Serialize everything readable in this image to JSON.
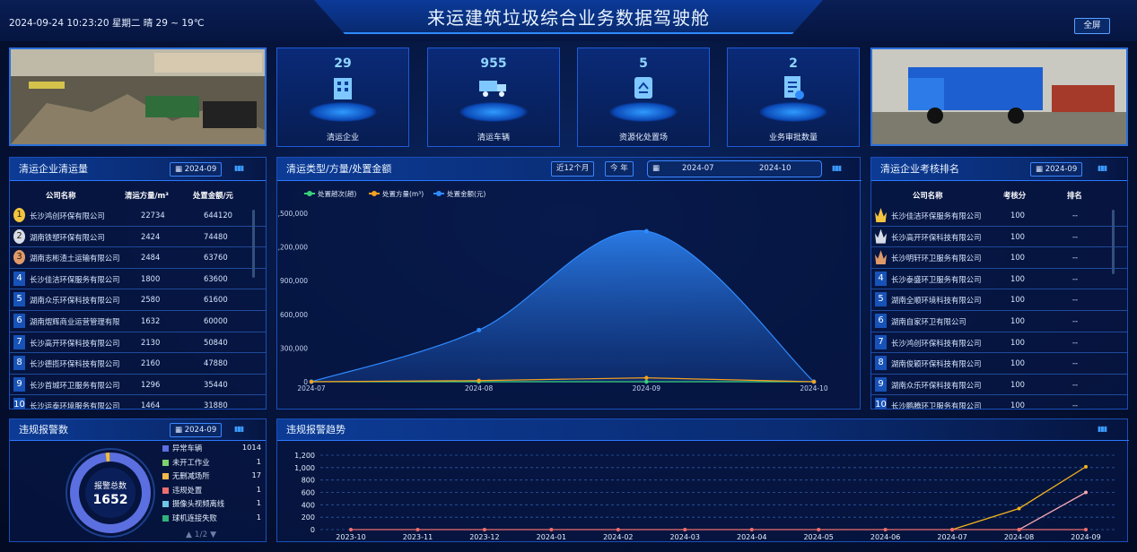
{
  "header": {
    "datetime": "2024-09-24 10:23:20 星期二 晴 29 ~ 19℃",
    "title": "来运建筑垃圾综合业务数据驾驶舱",
    "fullscreen_label": "全屏"
  },
  "stats": [
    {
      "value": "29",
      "label": "清运企业",
      "icon": "building-icon"
    },
    {
      "value": "955",
      "label": "清运车辆",
      "icon": "truck-icon"
    },
    {
      "value": "5",
      "label": "资源化处置场",
      "icon": "recycle-bin-icon"
    },
    {
      "value": "2",
      "label": "业务审批数量",
      "icon": "document-approval-icon"
    }
  ],
  "left_panel": {
    "title": "清运企业清运量",
    "date": "2024-09",
    "headers": [
      "公司名称",
      "清运方量/m³",
      "处置金额/元"
    ],
    "rows": [
      {
        "rank": "1",
        "name": "长沙鸿创环保有限公司",
        "volume": "22734",
        "amount": "644120"
      },
      {
        "rank": "2",
        "name": "湖南铁塑环保有限公司",
        "volume": "2424",
        "amount": "74480"
      },
      {
        "rank": "3",
        "name": "湖南志彬渣土运输有限公司",
        "volume": "2484",
        "amount": "63760"
      },
      {
        "rank": "4",
        "name": "长沙佳洁环保服务有限公司",
        "volume": "1800",
        "amount": "63600"
      },
      {
        "rank": "5",
        "name": "湖南众乐环保科技有限公司",
        "volume": "2580",
        "amount": "61600"
      },
      {
        "rank": "6",
        "name": "湖南熠辉商业运营管理有限公司",
        "volume": "1632",
        "amount": "60000"
      },
      {
        "rank": "7",
        "name": "长沙高开环保科技有限公司",
        "volume": "2130",
        "amount": "50840"
      },
      {
        "rank": "8",
        "name": "长沙德揽环保科技有限公司",
        "volume": "2160",
        "amount": "47880"
      },
      {
        "rank": "9",
        "name": "长沙首城环卫服务有限公司",
        "volume": "1296",
        "amount": "35440"
      },
      {
        "rank": "10",
        "name": "长沙运泰环境服务有限公司",
        "volume": "1464",
        "amount": "31880"
      }
    ]
  },
  "right_panel": {
    "title": "清运企业考核排名",
    "date": "2024-09",
    "headers": [
      "公司名称",
      "考核分",
      "排名"
    ],
    "rows": [
      {
        "rank": "1",
        "name": "长沙佳洁环保服务有限公司",
        "score": "100",
        "place": "--"
      },
      {
        "rank": "2",
        "name": "长沙高开环保科技有限公司",
        "score": "100",
        "place": "--"
      },
      {
        "rank": "3",
        "name": "长沙明轩环卫服务有限公司",
        "score": "100",
        "place": "--"
      },
      {
        "rank": "4",
        "name": "长沙泰盛环卫服务有限公司",
        "score": "100",
        "place": "--"
      },
      {
        "rank": "5",
        "name": "湖南全顺环境科技有限公司",
        "score": "100",
        "place": "--"
      },
      {
        "rank": "6",
        "name": "湖南自家环卫有限公司",
        "score": "100",
        "place": "--"
      },
      {
        "rank": "7",
        "name": "长沙鸿创环保科技有限公司",
        "score": "100",
        "place": "--"
      },
      {
        "rank": "8",
        "name": "湖南俊颖环保科技有限公司",
        "score": "100",
        "place": "--"
      },
      {
        "rank": "9",
        "name": "湖南众乐环保科技有限公司",
        "score": "100",
        "place": "--"
      },
      {
        "rank": "10",
        "name": "长沙鹏腾环卫服务有限公司",
        "score": "100",
        "place": "--"
      }
    ]
  },
  "center_panel": {
    "title": "清运类型/方量/处置金额",
    "btn_12m": "近12个月",
    "btn_year": "今 年",
    "date_from": "2024-07",
    "date_to": "2024-10"
  },
  "alarm_panel": {
    "title": "违规报警数",
    "date": "2024-09",
    "total_label": "报警总数",
    "total": "1652",
    "pager": "1/2",
    "items": [
      {
        "name": "异常车辆",
        "count": "1014",
        "color": "#5b6fe0"
      },
      {
        "name": "未开工作业",
        "count": "1",
        "color": "#7dd36b"
      },
      {
        "name": "无删减场所",
        "count": "17",
        "color": "#f2b84b"
      },
      {
        "name": "违规处置",
        "count": "1",
        "color": "#ef6f6f"
      },
      {
        "name": "摄像头视频离线",
        "count": "1",
        "color": "#6cc6e8"
      },
      {
        "name": "球机连接失败",
        "count": "1",
        "color": "#2fb37a"
      }
    ]
  },
  "trend_panel": {
    "title": "违规报警趋势"
  },
  "chart_data": [
    {
      "type": "area",
      "title": "清运类型/方量/处置金额",
      "x": [
        "2024-07",
        "2024-08",
        "2024-09",
        "2024-10"
      ],
      "series": [
        {
          "name": "处置趟次(趟)",
          "values": [
            0,
            0,
            0,
            0
          ],
          "color": "#3ad17a"
        },
        {
          "name": "处置方量(m³)",
          "values": [
            0,
            10000,
            35000,
            0
          ],
          "color": "#f5a020"
        },
        {
          "name": "处置金额(元)",
          "values": [
            0,
            460000,
            1340000,
            0
          ],
          "color": "#2f8bff"
        }
      ],
      "yticks": [
        "0",
        "300,000",
        "600,000",
        "900,000",
        "1,200,000",
        "1,500,000"
      ],
      "ylim": [
        0,
        1500000
      ],
      "legend": "top-left"
    },
    {
      "type": "line",
      "title": "违规报警趋势",
      "x": [
        "2023-10",
        "2023-11",
        "2023-12",
        "2024-01",
        "2024-02",
        "2024-03",
        "2024-04",
        "2024-05",
        "2024-06",
        "2024-07",
        "2024-08",
        "2024-09"
      ],
      "series": [
        {
          "values": [
            null,
            null,
            null,
            null,
            null,
            null,
            null,
            null,
            null,
            0,
            340,
            1014
          ],
          "color": "#f2b21c"
        },
        {
          "values": [
            null,
            null,
            null,
            null,
            null,
            null,
            null,
            null,
            null,
            null,
            0,
            600
          ],
          "color": "#f2a7b2"
        },
        {
          "values": [
            0,
            0,
            0,
            0,
            0,
            0,
            0,
            0,
            0,
            0,
            0,
            0
          ],
          "color": "#ef6f6f"
        }
      ],
      "yticks": [
        "0",
        "200",
        "400",
        "600",
        "800",
        "1,000",
        "1,200"
      ],
      "ylim": [
        0,
        1200
      ]
    }
  ]
}
